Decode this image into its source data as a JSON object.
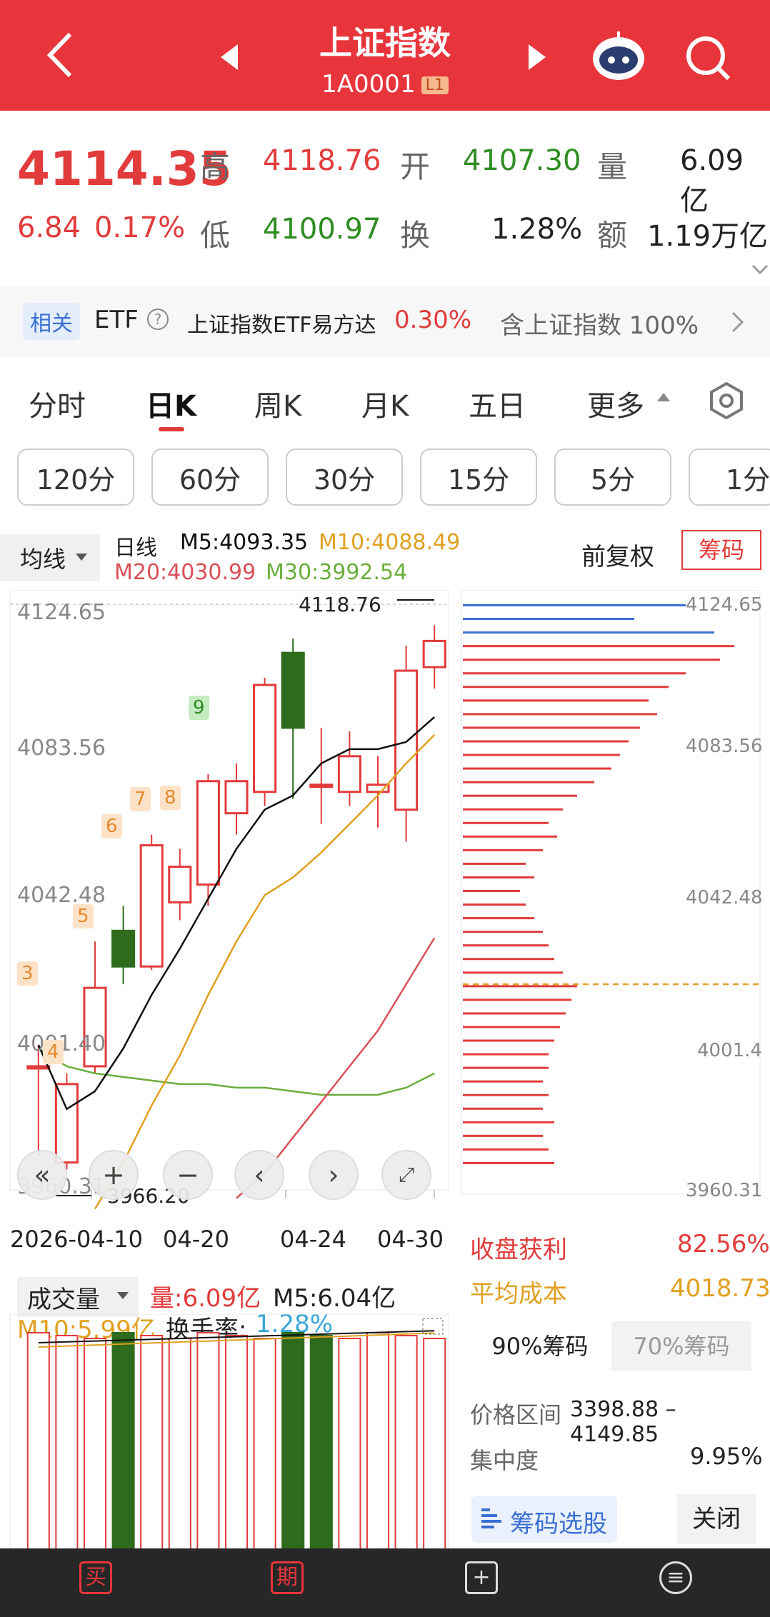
{
  "header": {
    "title": "上证指数",
    "code": "1A0001",
    "level": "L1"
  },
  "quote": {
    "price": "4114.35",
    "change": "6.84",
    "change_pct": "0.17%",
    "high_label": "高",
    "high": "4118.76",
    "open_label": "开",
    "open": "4107.30",
    "vol_label": "量",
    "vol": "6.09亿",
    "low_label": "低",
    "low": "4100.97",
    "turn_label": "换",
    "turn": "1.28%",
    "amt_label": "额",
    "amt": "1.19万亿"
  },
  "etf": {
    "tag": "相关",
    "label": "ETF",
    "name": "上证指数ETF易方达",
    "pct": "0.30%",
    "desc": "含上证指数 100%"
  },
  "tabs": [
    "分时",
    "日K",
    "周K",
    "月K",
    "五日",
    "更多"
  ],
  "intervals": [
    "120分",
    "60分",
    "30分",
    "15分",
    "5分",
    "1分"
  ],
  "ma": {
    "select": "均线",
    "kline": "日线",
    "m5": "M5:4093.35",
    "m10": "M10:4088.49",
    "m20": "M20:4030.99",
    "m30": "M30:3992.54",
    "adjust": "前复权",
    "chips": "筹码"
  },
  "chart_labels": {
    "y1": "4124.65",
    "y2": "4083.56",
    "y3": "4042.48",
    "y4": "4001.40",
    "y5": "3960.31",
    "high_mark": "4118.76",
    "low_mark": "3966.20",
    "d1": "2026-04-10",
    "d2": "04-20",
    "d3": "04-24",
    "d4": "04-30",
    "seq": [
      "3",
      "4",
      "5",
      "6",
      "7",
      "8",
      "9"
    ]
  },
  "chip_labels": {
    "y1": "4124.65",
    "y2": "4083.56",
    "y3": "4042.48",
    "y4": "4001.4",
    "y5": "3960.31"
  },
  "chip_stats": {
    "profit_label": "收盘获利",
    "profit": "82.56%",
    "cost_label": "平均成本",
    "cost": "4018.73",
    "tab90": "90%筹码",
    "tab70": "70%筹码",
    "range_label": "价格区间",
    "range": "3398.88 – 4149.85",
    "conc_label": "集中度",
    "conc": "9.95%",
    "pick": "筹码选股",
    "close": "关闭"
  },
  "volume": {
    "select": "成交量",
    "vol": "量:6.09亿",
    "m5": "M5:6.04亿",
    "m10": "M10:5.99亿",
    "turn_label": "换手率:",
    "turn": "1.28%"
  },
  "colors": {
    "up": "#e23b3b",
    "down": "#2e6b1c",
    "m5": "#111111",
    "m10": "#e0a020",
    "m20": "#d9505a",
    "m30": "#6aae3c"
  },
  "chart_data": {
    "type": "candlestick",
    "ylim": [
      3960.31,
      4124.65
    ],
    "candles": [
      {
        "o": 3995,
        "c": 3995,
        "h": 4001,
        "l": 3970,
        "up": true
      },
      {
        "o": 3968,
        "c": 3990,
        "h": 3993,
        "l": 3966,
        "up": true
      },
      {
        "o": 3995,
        "c": 4017,
        "h": 4030,
        "l": 3993,
        "up": true
      },
      {
        "o": 4033,
        "c": 4023,
        "h": 4040,
        "l": 4018,
        "up": false
      },
      {
        "o": 4023,
        "c": 4057,
        "h": 4060,
        "l": 4022,
        "up": true
      },
      {
        "o": 4041,
        "c": 4051,
        "h": 4056,
        "l": 4036,
        "up": true
      },
      {
        "o": 4046,
        "c": 4075,
        "h": 4077,
        "l": 4040,
        "up": true
      },
      {
        "o": 4066,
        "c": 4075,
        "h": 4080,
        "l": 4060,
        "up": true
      },
      {
        "o": 4072,
        "c": 4102,
        "h": 4104,
        "l": 4068,
        "up": true
      },
      {
        "o": 4111,
        "c": 4090,
        "h": 4115,
        "l": 4070,
        "up": false
      },
      {
        "o": 4074,
        "c": 4074,
        "h": 4090,
        "l": 4063,
        "up": true
      },
      {
        "o": 4072,
        "c": 4082,
        "h": 4089,
        "l": 4068,
        "up": true
      },
      {
        "o": 4072,
        "c": 4074,
        "h": 4082,
        "l": 4062,
        "up": true
      },
      {
        "o": 4067,
        "c": 4106,
        "h": 4113,
        "l": 4058,
        "up": true
      },
      {
        "o": 4107,
        "c": 4114.35,
        "h": 4118.76,
        "l": 4100.97,
        "up": true
      }
    ],
    "ma5": [
      4001,
      3983,
      3988,
      4000,
      4015,
      4028,
      4042,
      4056,
      4067,
      4071,
      4080,
      4084,
      4084,
      4086,
      4093
    ],
    "ma10": [
      null,
      null,
      3955,
      3968,
      3984,
      3998,
      4015,
      4030,
      4043,
      4048,
      4055,
      4063,
      4071,
      4080,
      4088
    ],
    "ma20": [
      null,
      null,
      null,
      null,
      null,
      null,
      null,
      3958,
      3965,
      3975,
      3985,
      3995,
      4005,
      4018,
      4031
    ],
    "ma30": [
      4000,
      3995,
      3993,
      3992,
      3991,
      3990,
      3990,
      3989,
      3989,
      3988,
      3987,
      3987,
      3987,
      3989,
      3993
    ],
    "volume_up": [
      true,
      true,
      true,
      false,
      true,
      true,
      true,
      true,
      true,
      false,
      false,
      true,
      true,
      true,
      true
    ],
    "chip_bars": [
      0.78,
      0.6,
      0.88,
      0.95,
      0.9,
      0.78,
      0.72,
      0.65,
      0.68,
      0.62,
      0.58,
      0.55,
      0.52,
      0.46,
      0.4,
      0.35,
      0.3,
      0.33,
      0.28,
      0.22,
      0.25,
      0.2,
      0.22,
      0.25,
      0.28,
      0.3,
      0.32,
      0.35,
      0.4,
      0.38,
      0.36,
      0.34,
      0.32,
      0.3,
      0.3,
      0.28,
      0.3,
      0.28,
      0.32,
      0.28,
      0.3,
      0.32
    ]
  }
}
